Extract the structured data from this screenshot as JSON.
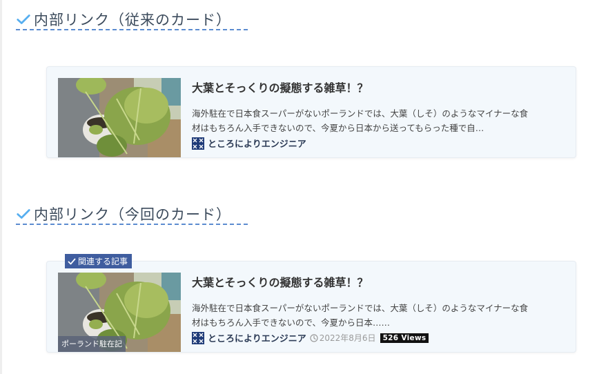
{
  "colors": {
    "accent_check": "#56aef0",
    "heading_underline": "#5b8bd0",
    "card_bg": "#f3f8fc",
    "badge_bg": "#3f5d9f",
    "views_bg": "#111111"
  },
  "section1": {
    "heading": "内部リンク（従来のカード）",
    "card": {
      "title": "大葉とそっくりの擬態する雑草！？",
      "excerpt_line1": "海外駐在で日本食スーパーがないポーランドでは、大葉（しそ）のようなマイナーな食",
      "excerpt_line2": "材はもちろん入手できないので、今夏から日本から送ってもらった種で自…",
      "site_name": "ところによりエンジニア"
    }
  },
  "section2": {
    "heading": "内部リンク（今回のカード）",
    "badge": "関連する記事",
    "card": {
      "title": "大葉とそっくりの擬態する雑草！？",
      "excerpt_line1": "海外駐在で日本食スーパーがないポーランドでは、大葉（しそ）のようなマイナーな食",
      "excerpt_line2": "材はもちろん入手できないので、今夏から日本……",
      "site_name": "ところによりエンジニア",
      "date": "2022年8月6日",
      "views": "526 Views",
      "category": "ポーランド駐在記"
    }
  }
}
